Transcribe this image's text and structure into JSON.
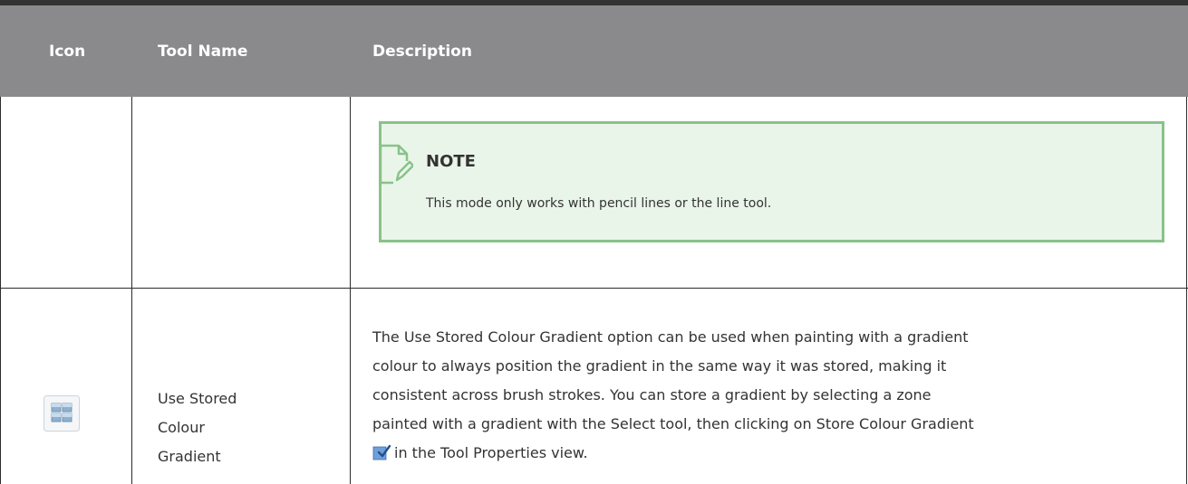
{
  "table": {
    "headers": {
      "icon": "Icon",
      "tool_name": "Tool Name",
      "description": "Description"
    },
    "note": {
      "title": "NOTE",
      "text": "This mode only works with pencil lines or the line tool."
    },
    "row": {
      "tool_name_lines": [
        "Use Stored",
        "Colour",
        "Gradient"
      ],
      "description_lines": [
        "The Use Stored Colour Gradient option can be used when painting with a gradient",
        "colour to always position the gradient in the same way it was stored, making it",
        "consistent across brush strokes. You can store a gradient by selecting a zone",
        "painted with a gradient with the Select tool, then clicking on Store Colour Gradient",
        "in the Tool Properties view."
      ],
      "icon_name": "grid-icon",
      "inline_icon_name": "store-colour-gradient-icon"
    },
    "colors": {
      "header_bg": "#8a8a8c",
      "note_bg": "#eaf5ea",
      "note_border": "#8ac28a"
    }
  }
}
